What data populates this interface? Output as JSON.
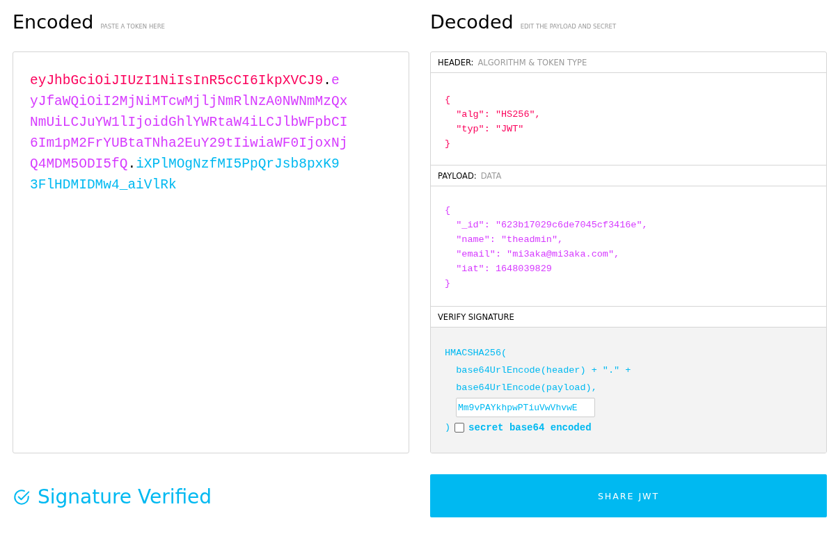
{
  "encoded": {
    "title": "Encoded",
    "hint": "PASTE A TOKEN HERE",
    "token": [
      {
        "kind": "header",
        "text": "eyJhbGciOiJIUzI1NiIsInR5cCI6IkpXVCJ9"
      },
      {
        "kind": "dot",
        "text": "."
      },
      {
        "kind": "payload",
        "text": "eyJfaWQiOiI2MjNiMTcwMjljNmRlNzA0NWNmMzQxNmUiLCJuYW1lIjoidGhlYWRtaW4iLCJlbWFpbCI6Im1pM2FrYUBtaTNha2EuY29tIiwiaWF0IjoxNjQ4MDM5ODI5fQ"
      },
      {
        "kind": "dot",
        "text": "."
      },
      {
        "kind": "signature",
        "text": "iXPlMOgNzfMI5PpQrJsb8pxK93FlHDMIDMw4_aiVlRk"
      }
    ]
  },
  "decoded": {
    "title": "Decoded",
    "hint": "EDIT THE PAYLOAD AND SECRET",
    "sections": [
      {
        "kind": "header",
        "label": "HEADER:",
        "sublabel": "ALGORITHM & TOKEN TYPE",
        "lines": [
          "{",
          "  \"alg\": \"HS256\",",
          "  \"typ\": \"JWT\"",
          "}"
        ]
      },
      {
        "kind": "payload",
        "label": "PAYLOAD:",
        "sublabel": "DATA",
        "lines": [
          "{",
          "  \"_id\": \"623b17029c6de7045cf3416e\",",
          "  \"name\": \"theadmin\",",
          "  \"email\": \"mi3aka@mi3aka.com\",",
          "  \"iat\": 1648039829",
          "}"
        ]
      },
      {
        "kind": "signature",
        "label": "VERIFY SIGNATURE",
        "lines": [
          "HMACSHA256(",
          "  base64UrlEncode(header) + \".\" +",
          "  base64UrlEncode(payload),"
        ],
        "secret": "Mm9vPAYkhpwPTiuVwVhvwE",
        "close": ")",
        "checkbox": {
          "label": "secret base64 encoded",
          "checked": false
        }
      }
    ]
  },
  "status": {
    "kind": "verified",
    "text": "Signature Verified"
  },
  "share_button": "SHARE JWT"
}
